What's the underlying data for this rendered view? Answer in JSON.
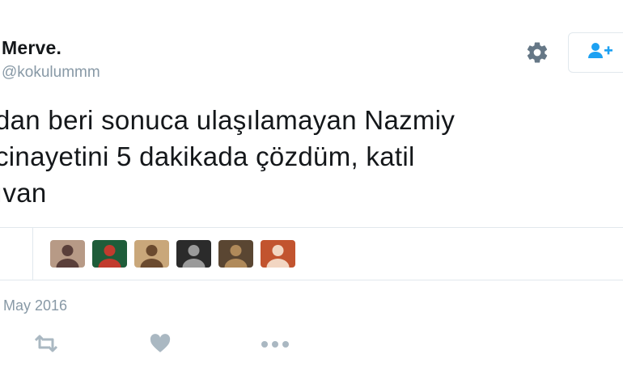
{
  "author": {
    "name": "Merve.",
    "handle": "@kokulummm"
  },
  "tweet": {
    "lines": [
      "dan beri sonuca ulaşılamayan Nazmiy",
      "cinayetini 5 dakikada çözdüm, katil",
      "ıvan"
    ],
    "date": "May 2016"
  },
  "liked_by_avatars": [
    {
      "bg": "#b79a86",
      "fg": "#5a3f3a"
    },
    {
      "bg": "#1f5d3a",
      "fg": "#c23b2e"
    },
    {
      "bg": "#c9a77a",
      "fg": "#6b4a2e"
    },
    {
      "bg": "#2b2b2b",
      "fg": "#9a9a9a"
    },
    {
      "bg": "#5a4632",
      "fg": "#b08a5a"
    },
    {
      "bg": "#c2542f",
      "fg": "#f2d6c2"
    }
  ],
  "icons": {
    "settings": "gear-icon",
    "follow": "add-user-icon",
    "retweet": "retweet-icon",
    "like": "heart-icon",
    "more": "more-dots-icon"
  },
  "colors": {
    "accent": "#1da1f2",
    "muted": "#8899a6",
    "text": "#14171a",
    "border": "#e1e8ed"
  }
}
